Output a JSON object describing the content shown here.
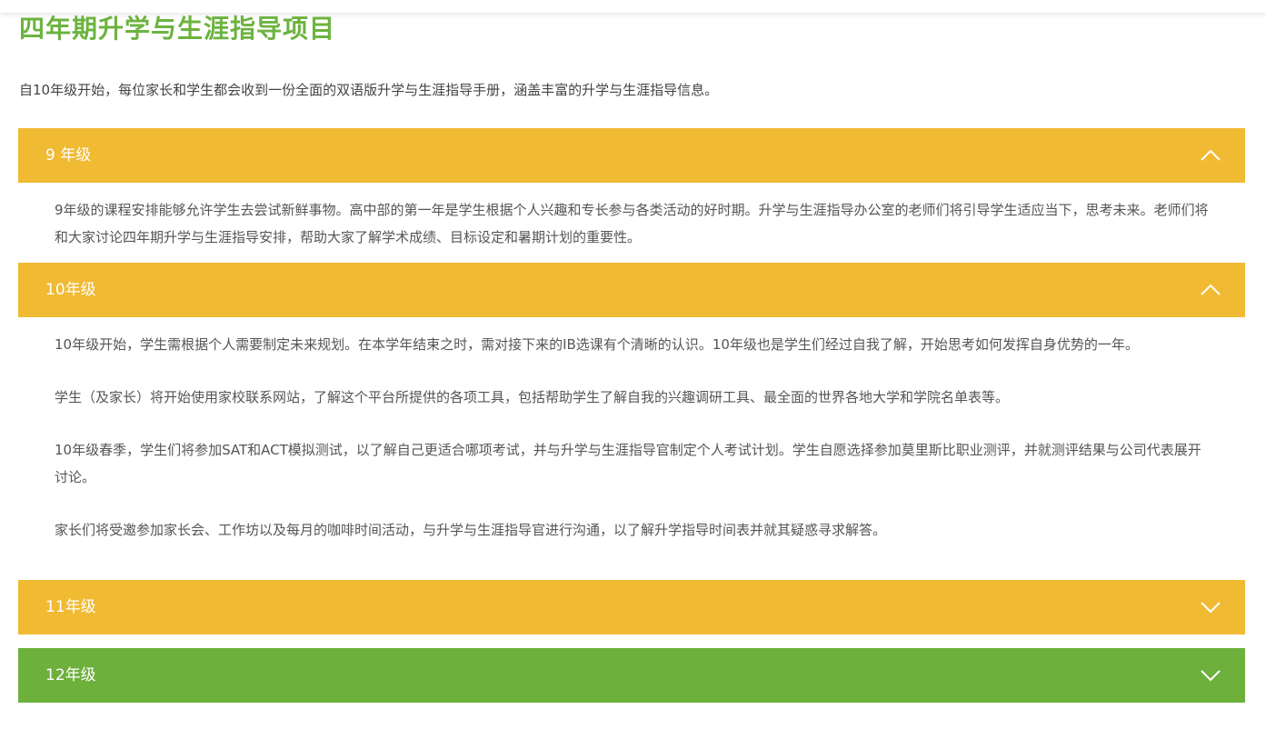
{
  "page": {
    "title": "四年期升学与生涯指导项目",
    "intro": "自10年级开始，每位家长和学生都会收到一份全面的双语版升学与生涯指导手册，涵盖丰富的升学与生涯指导信息。"
  },
  "colors": {
    "title_green": "#6cb33f",
    "header_yellow": "#f0ba33",
    "header_green": "#6db03c"
  },
  "accordion": {
    "grade9": {
      "label": "9 年级",
      "state": "expanded",
      "icon": "chevron-up-icon",
      "paragraphs": [
        "9年级的课程安排能够允许学生去尝试新鲜事物。高中部的第一年是学生根据个人兴趣和专长参与各类活动的好时期。升学与生涯指导办公室的老师们将引导学生适应当下，思考未来。老师们将和大家讨论四年期升学与生涯指导安排，帮助大家了解学术成绩、目标设定和暑期计划的重要性。"
      ]
    },
    "grade10": {
      "label": "10年级",
      "state": "expanded",
      "icon": "chevron-up-icon",
      "paragraphs": [
        "10年级开始，学生需根据个人需要制定未来规划。在本学年结束之时，需对接下来的IB选课有个清晰的认识。10年级也是学生们经过自我了解，开始思考如何发挥自身优势的一年。",
        "学生（及家长）将开始使用家校联系网站，了解这个平台所提供的各项工具，包括帮助学生了解自我的兴趣调研工具、最全面的世界各地大学和学院名单表等。",
        "10年级春季，学生们将参加SAT和ACT模拟测试，以了解自己更适合哪项考试，并与升学与生涯指导官制定个人考试计划。学生自愿选择参加莫里斯比职业测评，并就测评结果与公司代表展开讨论。",
        "家长们将受邀参加家长会、工作坊以及每月的咖啡时间活动，与升学与生涯指导官进行沟通，以了解升学指导时间表并就其疑惑寻求解答。"
      ]
    },
    "grade11": {
      "label": "11年级",
      "state": "collapsed",
      "icon": "chevron-down-icon"
    },
    "grade12": {
      "label": "12年级",
      "state": "collapsed",
      "icon": "chevron-down-icon"
    }
  }
}
